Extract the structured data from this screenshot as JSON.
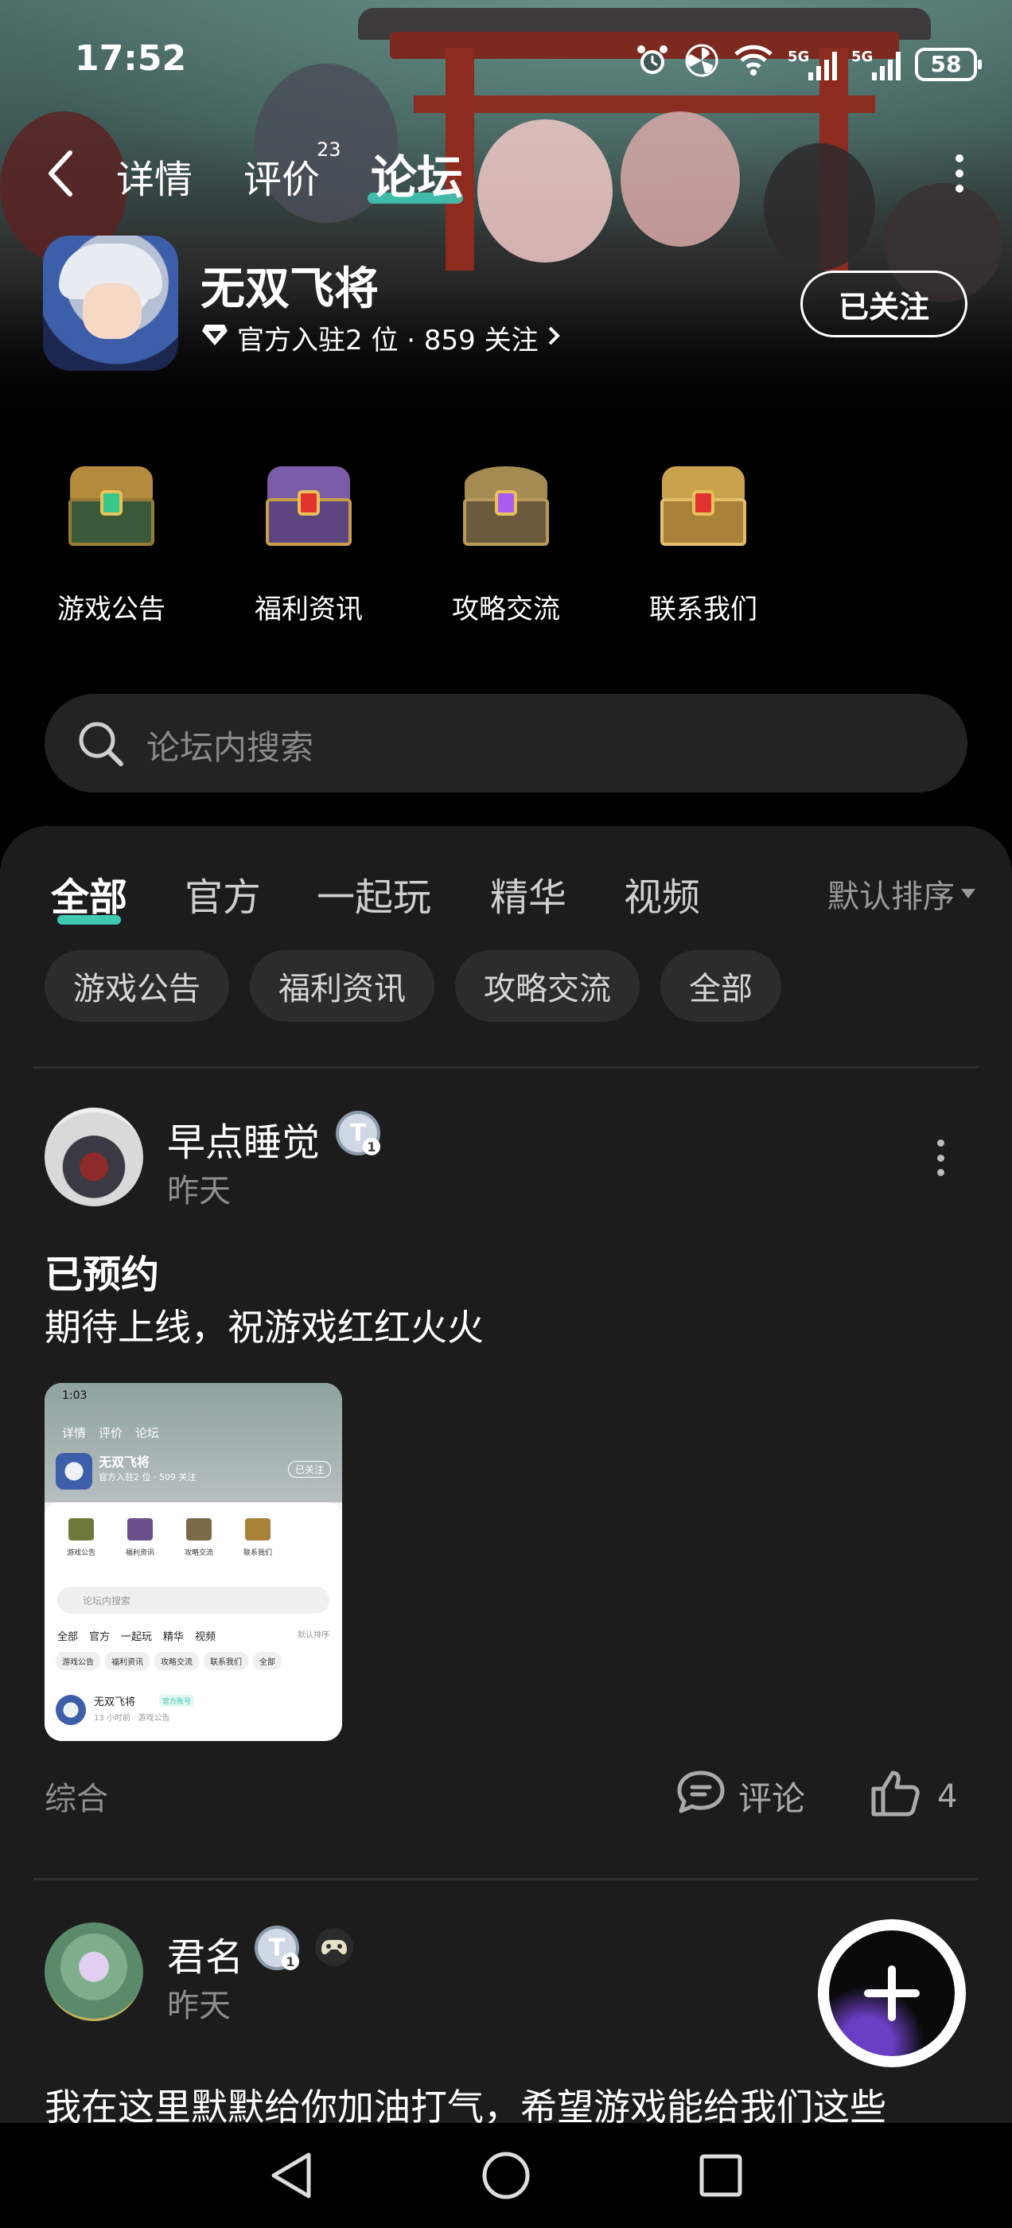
{
  "status_bar": {
    "time": "17:52",
    "network_label_1": "5G",
    "network_label_2": "5G",
    "battery": "58"
  },
  "top_nav": {
    "tabs": [
      {
        "label": "详情",
        "active": false
      },
      {
        "label": "评价",
        "active": false,
        "badge": "23"
      },
      {
        "label": "论坛",
        "active": true
      }
    ]
  },
  "game": {
    "name": "无双飞将",
    "meta": "官方入驻2 位 · 859 关注",
    "follow_label": "已关注"
  },
  "categories": [
    {
      "label": "游戏公告",
      "icon": "green-treasure-chest-icon"
    },
    {
      "label": "福利资讯",
      "icon": "purple-treasure-chest-icon"
    },
    {
      "label": "攻略交流",
      "icon": "purple-lantern-chest-icon"
    },
    {
      "label": "联系我们",
      "icon": "gold-treasure-chest-icon"
    }
  ],
  "search": {
    "placeholder": "论坛内搜索"
  },
  "feed_tabs": {
    "items": [
      "全部",
      "官方",
      "一起玩",
      "精华",
      "视频"
    ],
    "active": "全部",
    "sort_label": "默认排序"
  },
  "chips": [
    "游戏公告",
    "福利资讯",
    "攻略交流",
    "全部"
  ],
  "posts": [
    {
      "user": "早点睡觉",
      "level": "1",
      "time": "昨天",
      "title": "已预约",
      "body": "期待上线，祝游戏红红火火",
      "tag": "综合",
      "comment_label": "评论",
      "likes": "4",
      "thumbnail": {
        "time": "1:03",
        "nav": [
          "详情",
          "评价",
          "论坛"
        ],
        "name": "无双飞将",
        "meta": "官方入驻2 位 · 509 关注",
        "follow": "已关注",
        "cats": [
          "游戏公告",
          "福利资讯",
          "攻略交流",
          "联系我们"
        ],
        "search": "论坛内搜索",
        "tabs": [
          "全部",
          "官方",
          "一起玩",
          "精华",
          "视频"
        ],
        "sort": "默认排序",
        "chips": [
          "游戏公告",
          "福利资讯",
          "攻略交流",
          "联系我们",
          "全部"
        ],
        "post_name": "无双飞将",
        "post_badge": "官方账号",
        "post_meta": "13 小时前 · 游戏公告"
      }
    },
    {
      "user": "君名",
      "level": "1",
      "time": "昨天",
      "body": "我在这里默默给你加油打气，希望游戏能给我们这些"
    }
  ],
  "colors": {
    "accent": "#3fc8b4",
    "panel_bg": "#1c1c1c",
    "chip_bg": "#2c2c2c",
    "search_bg": "#232323"
  }
}
